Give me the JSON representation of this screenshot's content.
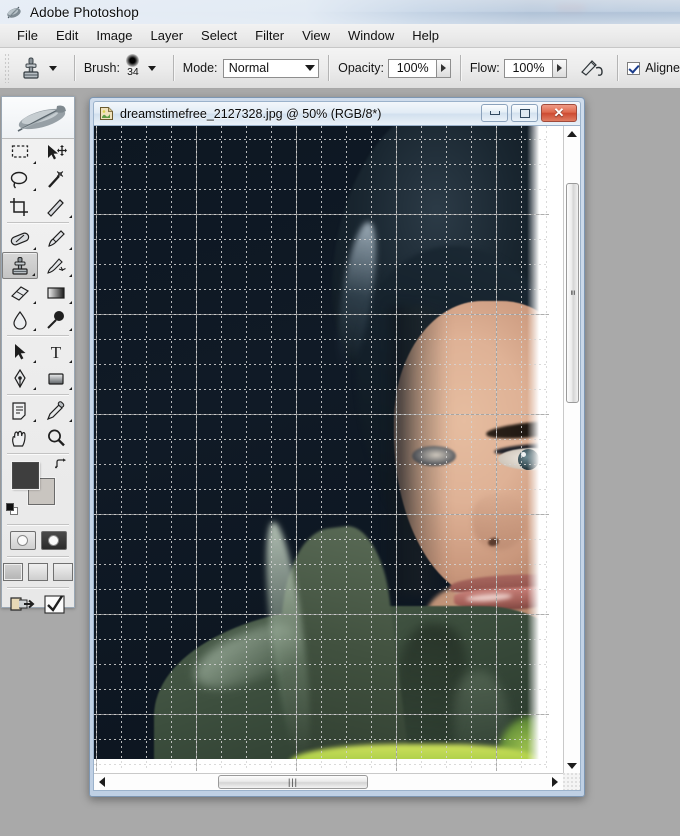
{
  "app": {
    "title": "Adobe Photoshop",
    "icon": "photoshop-feather-icon"
  },
  "menubar": {
    "items": [
      {
        "label": "File"
      },
      {
        "label": "Edit"
      },
      {
        "label": "Image"
      },
      {
        "label": "Layer"
      },
      {
        "label": "Select"
      },
      {
        "label": "Filter"
      },
      {
        "label": "View"
      },
      {
        "label": "Window"
      },
      {
        "label": "Help"
      }
    ]
  },
  "options_bar": {
    "active_tool_icon": "clone-stamp-icon",
    "tool_preset_arrow": "chevron-down-icon",
    "brush_label": "Brush:",
    "brush_size": "34",
    "brush_arrow": "chevron-down-icon",
    "mode_label": "Mode:",
    "mode_value": "Normal",
    "opacity_label": "Opacity:",
    "opacity_value": "100%",
    "flow_label": "Flow:",
    "flow_value": "100%",
    "airbrush_icon": "airbrush-icon",
    "aligned_label": "Aligne",
    "aligned_checked": true
  },
  "toolbox": {
    "handle_icon": "photoshop-feather-logo",
    "tools": [
      {
        "name": "rectangular-marquee-tool",
        "glyph": "marquee",
        "has_submenu": true,
        "selected": false
      },
      {
        "name": "move-tool",
        "glyph": "move",
        "has_submenu": false,
        "selected": false
      },
      {
        "name": "lasso-tool",
        "glyph": "lasso",
        "has_submenu": true,
        "selected": false
      },
      {
        "name": "magic-wand-tool",
        "glyph": "wand",
        "has_submenu": false,
        "selected": false
      },
      {
        "name": "crop-tool",
        "glyph": "crop",
        "has_submenu": false,
        "selected": false
      },
      {
        "name": "slice-tool",
        "glyph": "slice",
        "has_submenu": true,
        "selected": false
      },
      {
        "name": "healing-brush-tool",
        "glyph": "heal",
        "has_submenu": true,
        "selected": false
      },
      {
        "name": "brush-tool",
        "glyph": "brush",
        "has_submenu": true,
        "selected": false
      },
      {
        "name": "clone-stamp-tool",
        "glyph": "stamp",
        "has_submenu": true,
        "selected": true
      },
      {
        "name": "history-brush-tool",
        "glyph": "historybrush",
        "has_submenu": true,
        "selected": false
      },
      {
        "name": "eraser-tool",
        "glyph": "eraser",
        "has_submenu": true,
        "selected": false
      },
      {
        "name": "gradient-tool",
        "glyph": "gradient",
        "has_submenu": true,
        "selected": false
      },
      {
        "name": "blur-tool",
        "glyph": "blur",
        "has_submenu": true,
        "selected": false
      },
      {
        "name": "dodge-tool",
        "glyph": "dodge",
        "has_submenu": true,
        "selected": false
      },
      {
        "name": "path-selection-tool",
        "glyph": "pathsel",
        "has_submenu": true,
        "selected": false
      },
      {
        "name": "type-tool",
        "glyph": "type",
        "has_submenu": true,
        "selected": false
      },
      {
        "name": "pen-tool",
        "glyph": "pen",
        "has_submenu": true,
        "selected": false
      },
      {
        "name": "rectangle-shape-tool",
        "glyph": "shape",
        "has_submenu": true,
        "selected": false
      },
      {
        "name": "notes-tool",
        "glyph": "notes",
        "has_submenu": true,
        "selected": false
      },
      {
        "name": "eyedropper-tool",
        "glyph": "eyedropper",
        "has_submenu": true,
        "selected": false
      },
      {
        "name": "hand-tool",
        "glyph": "hand",
        "has_submenu": false,
        "selected": false
      },
      {
        "name": "zoom-tool",
        "glyph": "zoom",
        "has_submenu": false,
        "selected": false
      }
    ],
    "colors": {
      "foreground": "#3e3e3e",
      "background": "#c9c5c0",
      "swap_icon": "swap-arrow-icon",
      "default_icon": "default-colors-icon"
    },
    "quick_mask": [
      {
        "name": "standard-mode-button",
        "active": true
      },
      {
        "name": "quick-mask-mode-button",
        "active": false
      }
    ],
    "screen_modes": [
      {
        "name": "standard-screen-mode-button",
        "active": true
      },
      {
        "name": "full-screen-menubar-mode-button",
        "active": false
      },
      {
        "name": "full-screen-mode-button",
        "active": false
      }
    ],
    "jump_to": [
      {
        "name": "edit-in-imageready-button"
      },
      {
        "name": "checkmark-button"
      }
    ]
  },
  "document": {
    "icon": "image-document-icon",
    "title": "dreamstimefree_2127328.jpg @ 50% (RGB/8*)",
    "filename": "dreamstimefree_2127328.jpg",
    "zoom": "50%",
    "color_mode": "RGB/8*",
    "window_buttons": [
      {
        "name": "minimize-button",
        "glyph": "minimize"
      },
      {
        "name": "maximize-button",
        "glyph": "maximize"
      },
      {
        "name": "close-button",
        "glyph": "close",
        "color": "#cd4b32"
      }
    ],
    "canvas": {
      "description": "Portrait photo of a young woman with dark hair wearing a green military-style jacket with a white collar, dark background, grass at bottom right",
      "grid_visible": true,
      "grid_major_spacing_px": 100,
      "grid_subdivisions": 4
    },
    "scrollbars": {
      "vertical": {
        "name": "vertical-scrollbar",
        "thumb_top_pct": 8,
        "thumb_height_pct": 34
      },
      "horizontal": {
        "name": "horizontal-scrollbar",
        "thumb_left_pct": 28,
        "thumb_width_pct": 34
      }
    }
  }
}
